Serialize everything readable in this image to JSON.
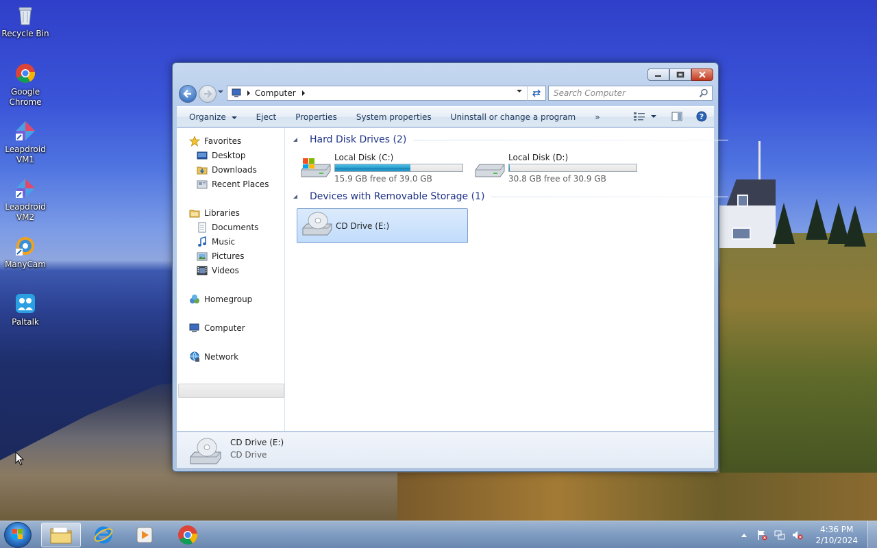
{
  "desktop": {
    "icons": [
      {
        "label": "Recycle Bin",
        "icon": "recycle-bin-icon"
      },
      {
        "label": "Google Chrome",
        "icon": "chrome-icon"
      },
      {
        "label": "Leapdroid VM1",
        "icon": "leapdroid-icon"
      },
      {
        "label": "Leapdroid VM2",
        "icon": "leapdroid-icon"
      },
      {
        "label": "ManyCam",
        "icon": "manycam-icon"
      },
      {
        "label": "Paltalk",
        "icon": "paltalk-icon"
      }
    ]
  },
  "window": {
    "address": {
      "crumb": "Computer"
    },
    "search": {
      "placeholder": "Search Computer"
    },
    "toolbar": {
      "organize": "Organize",
      "eject": "Eject",
      "properties": "Properties",
      "system_properties": "System properties",
      "uninstall": "Uninstall or change a program",
      "more": "»"
    },
    "nav": {
      "favorites": "Favorites",
      "desktop": "Desktop",
      "downloads": "Downloads",
      "recent_places": "Recent Places",
      "libraries": "Libraries",
      "documents": "Documents",
      "music": "Music",
      "pictures": "Pictures",
      "videos": "Videos",
      "homegroup": "Homegroup",
      "computer": "Computer",
      "network": "Network"
    },
    "groups": {
      "hard_disks": "Hard Disk Drives (2)",
      "removable": "Devices with Removable Storage (1)"
    },
    "drives": [
      {
        "name": "Local Disk (C:)",
        "free": "15.9 GB free of 39.0 GB",
        "used_fraction": 0.59
      },
      {
        "name": "Local Disk (D:)",
        "free": "30.8 GB free of 30.9 GB",
        "used_fraction": 0.003
      },
      {
        "name": "CD Drive (E:)",
        "selected": true
      }
    ],
    "details": {
      "title": "CD Drive (E:)",
      "subtitle": "CD Drive"
    }
  },
  "taskbar": {
    "apps": [
      "explorer",
      "internet-explorer",
      "media-player",
      "chrome"
    ],
    "clock": {
      "time": "4:36 PM",
      "date": "2/10/2024"
    }
  },
  "colors": {
    "accent": "#1e3287",
    "selection": "#c1dcfc",
    "progress": "#2b9fcf"
  }
}
